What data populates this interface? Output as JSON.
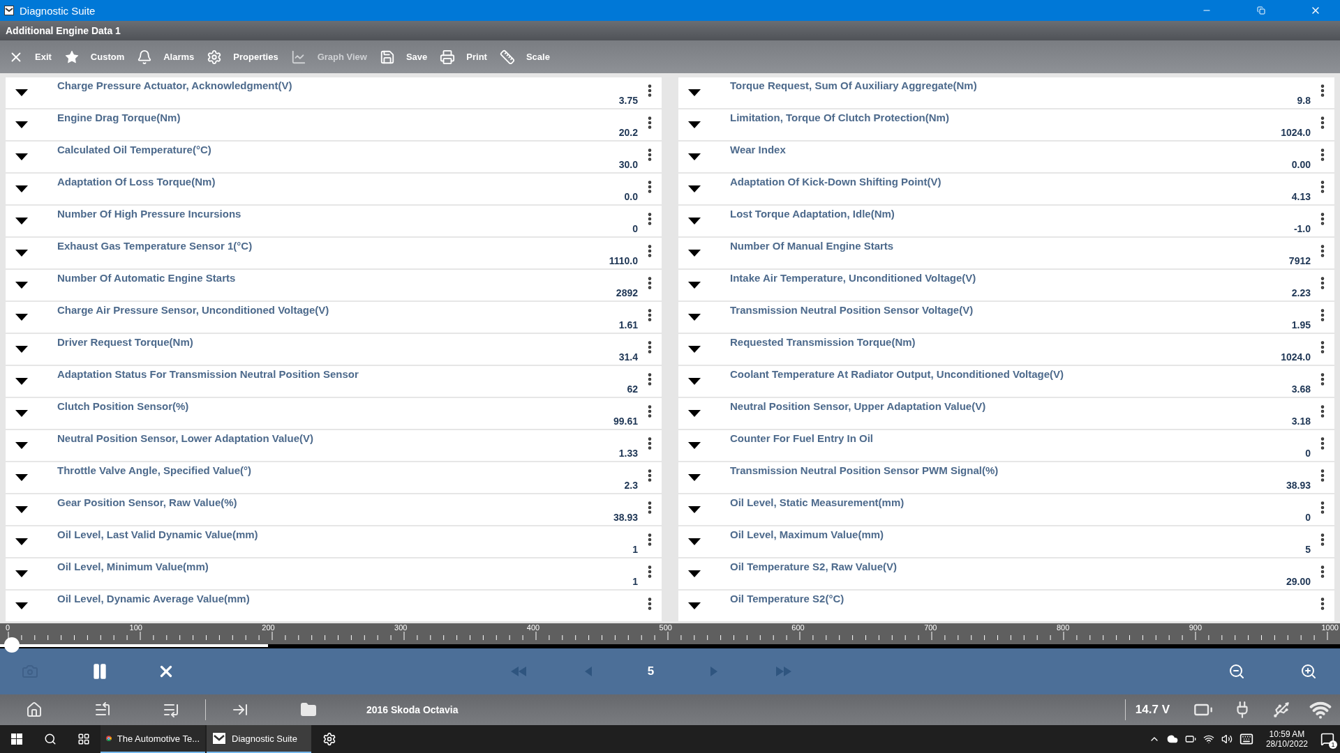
{
  "window": {
    "title": "Diagnostic Suite"
  },
  "subtitle": "Additional Engine Data 1",
  "toolbar": [
    {
      "kind": "exit",
      "label": "Exit",
      "disabled": false
    },
    {
      "kind": "custom",
      "label": "Custom",
      "disabled": false
    },
    {
      "kind": "alarms",
      "label": "Alarms",
      "disabled": false
    },
    {
      "kind": "properties",
      "label": "Properties",
      "disabled": false
    },
    {
      "kind": "graph",
      "label": "Graph View",
      "disabled": true
    },
    {
      "kind": "save",
      "label": "Save",
      "disabled": false
    },
    {
      "kind": "print",
      "label": "Print",
      "disabled": false
    },
    {
      "kind": "scale",
      "label": "Scale",
      "disabled": false
    }
  ],
  "columns": [
    [
      {
        "name": "Charge Pressure Actuator, Acknowledgment(V)",
        "value": "3.75"
      },
      {
        "name": "Engine Drag Torque(Nm)",
        "value": "20.2"
      },
      {
        "name": "Calculated Oil Temperature(°C)",
        "value": "30.0"
      },
      {
        "name": "Adaptation Of Loss Torque(Nm)",
        "value": "0.0"
      },
      {
        "name": "Number Of High Pressure Incursions",
        "value": "0"
      },
      {
        "name": "Exhaust Gas Temperature Sensor 1(°C)",
        "value": "1110.0"
      },
      {
        "name": "Number Of Automatic Engine Starts",
        "value": "2892"
      },
      {
        "name": "Charge Air Pressure Sensor, Unconditioned Voltage(V)",
        "value": "1.61"
      },
      {
        "name": "Driver Request Torque(Nm)",
        "value": "31.4"
      },
      {
        "name": "Adaptation Status For Transmission Neutral Position Sensor",
        "value": "62"
      },
      {
        "name": "Clutch Position Sensor(%)",
        "value": "99.61"
      },
      {
        "name": "Neutral Position Sensor, Lower Adaptation Value(V)",
        "value": "1.33"
      },
      {
        "name": "Throttle Valve Angle, Specified Value(°)",
        "value": "2.3"
      },
      {
        "name": "Gear Position Sensor, Raw Value(%)",
        "value": "38.93"
      },
      {
        "name": "Oil Level, Last Valid Dynamic Value(mm)",
        "value": "1"
      },
      {
        "name": "Oil Level, Minimum Value(mm)",
        "value": "1"
      },
      {
        "name": "Oil Level, Dynamic Average Value(mm)"
      }
    ],
    [
      {
        "name": "Torque Request, Sum Of Auxiliary Aggregate(Nm)",
        "value": "9.8"
      },
      {
        "name": "Limitation, Torque Of Clutch Protection(Nm)",
        "value": "1024.0"
      },
      {
        "name": "Wear Index",
        "value": "0.00"
      },
      {
        "name": "Adaptation Of Kick-Down Shifting Point(V)",
        "value": "4.13"
      },
      {
        "name": "Lost Torque Adaptation, Idle(Nm)",
        "value": "-1.0"
      },
      {
        "name": "Number Of Manual Engine Starts",
        "value": "7912"
      },
      {
        "name": "Intake Air Temperature, Unconditioned Voltage(V)",
        "value": "2.23"
      },
      {
        "name": "Transmission Neutral Position Sensor Voltage(V)",
        "value": "1.95"
      },
      {
        "name": "Requested Transmission Torque(Nm)",
        "value": "1024.0"
      },
      {
        "name": "Coolant Temperature At Radiator Output, Unconditioned Voltage(V)",
        "value": "3.68"
      },
      {
        "name": "Neutral Position Sensor, Upper Adaptation Value(V)",
        "value": "3.18"
      },
      {
        "name": "Counter For Fuel Entry In Oil",
        "value": "0"
      },
      {
        "name": "Transmission Neutral Position Sensor PWM Signal(%)",
        "value": "38.93"
      },
      {
        "name": "Oil Level, Static Measurement(mm)",
        "value": "0"
      },
      {
        "name": "Oil Level, Maximum Value(mm)",
        "value": "5"
      },
      {
        "name": "Oil Temperature S2, Raw Value(V)",
        "value": "29.00"
      },
      {
        "name": "Oil Temperature S2(°C)"
      }
    ]
  ],
  "timeline": {
    "ticks": [
      "0",
      "100",
      "200",
      "300",
      "400",
      "500",
      "600",
      "700",
      "800",
      "900",
      "1000"
    ],
    "level": 0.2
  },
  "page": "5",
  "status": {
    "vehicle": "2016 Skoda Octavia",
    "voltage": "14.7 V"
  },
  "taskbar": {
    "apps": [
      {
        "kind": "browser",
        "label": "The Automotive Te...",
        "selected": false
      },
      {
        "kind": "suite",
        "label": "Diagnostic Suite",
        "selected": true
      }
    ],
    "time": "10:59 AM",
    "date": "28/10/2022",
    "notifications": "1"
  }
}
